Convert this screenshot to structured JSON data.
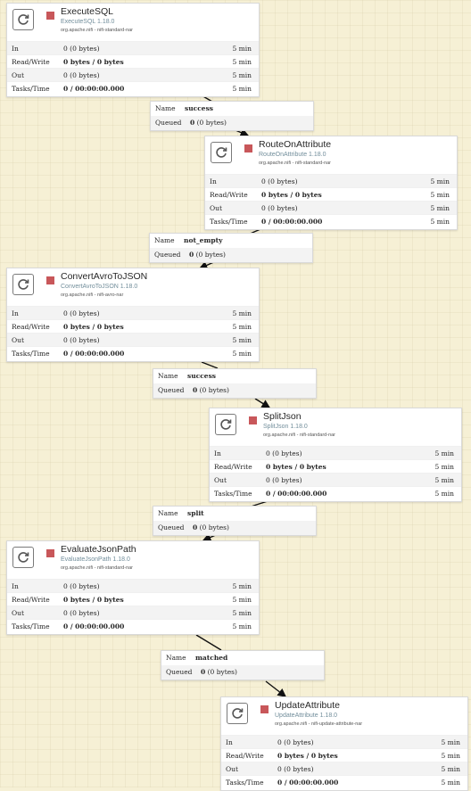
{
  "processors": [
    {
      "name": "ExecuteSQL",
      "type": "ExecuteSQL 1.18.0",
      "bundle": "org.apache.nifi - nifi-standard-nar",
      "stats": [
        {
          "label": "In",
          "value": "0 (0 bytes)",
          "time": "5 min"
        },
        {
          "label": "Read/Write",
          "value": "0 bytes / 0 bytes",
          "time": "5 min"
        },
        {
          "label": "Out",
          "value": "0 (0 bytes)",
          "time": "5 min"
        },
        {
          "label": "Tasks/Time",
          "value": "0 / 00:00:00.000",
          "time": "5 min"
        }
      ]
    },
    {
      "name": "RouteOnAttribute",
      "type": "RouteOnAttribute 1.18.0",
      "bundle": "org.apache.nifi - nifi-standard-nar",
      "stats": [
        {
          "label": "In",
          "value": "0 (0 bytes)",
          "time": "5 min"
        },
        {
          "label": "Read/Write",
          "value": "0 bytes / 0 bytes",
          "time": "5 min"
        },
        {
          "label": "Out",
          "value": "0 (0 bytes)",
          "time": "5 min"
        },
        {
          "label": "Tasks/Time",
          "value": "0 / 00:00:00.000",
          "time": "5 min"
        }
      ]
    },
    {
      "name": "ConvertAvroToJSON",
      "type": "ConvertAvroToJSON 1.18.0",
      "bundle": "org.apache.nifi - nifi-avro-nar",
      "stats": [
        {
          "label": "In",
          "value": "0 (0 bytes)",
          "time": "5 min"
        },
        {
          "label": "Read/Write",
          "value": "0 bytes / 0 bytes",
          "time": "5 min"
        },
        {
          "label": "Out",
          "value": "0 (0 bytes)",
          "time": "5 min"
        },
        {
          "label": "Tasks/Time",
          "value": "0 / 00:00:00.000",
          "time": "5 min"
        }
      ]
    },
    {
      "name": "SplitJson",
      "type": "SplitJson 1.18.0",
      "bundle": "org.apache.nifi - nifi-standard-nar",
      "stats": [
        {
          "label": "In",
          "value": "0 (0 bytes)",
          "time": "5 min"
        },
        {
          "label": "Read/Write",
          "value": "0 bytes / 0 bytes",
          "time": "5 min"
        },
        {
          "label": "Out",
          "value": "0 (0 bytes)",
          "time": "5 min"
        },
        {
          "label": "Tasks/Time",
          "value": "0 / 00:00:00.000",
          "time": "5 min"
        }
      ]
    },
    {
      "name": "EvaluateJsonPath",
      "type": "EvaluateJsonPath 1.18.0",
      "bundle": "org.apache.nifi - nifi-standard-nar",
      "stats": [
        {
          "label": "In",
          "value": "0 (0 bytes)",
          "time": "5 min"
        },
        {
          "label": "Read/Write",
          "value": "0 bytes / 0 bytes",
          "time": "5 min"
        },
        {
          "label": "Out",
          "value": "0 (0 bytes)",
          "time": "5 min"
        },
        {
          "label": "Tasks/Time",
          "value": "0 / 00:00:00.000",
          "time": "5 min"
        }
      ]
    },
    {
      "name": "UpdateAttribute",
      "type": "UpdateAttribute 1.18.0",
      "bundle": "org.apache.nifi - nifi-update-attribute-nar",
      "stats": [
        {
          "label": "In",
          "value": "0 (0 bytes)",
          "time": "5 min"
        },
        {
          "label": "Read/Write",
          "value": "0 bytes / 0 bytes",
          "time": "5 min"
        },
        {
          "label": "Out",
          "value": "0 (0 bytes)",
          "time": "5 min"
        },
        {
          "label": "Tasks/Time",
          "value": "0 / 00:00:00.000",
          "time": "5 min"
        }
      ]
    }
  ],
  "connections": [
    {
      "name_label": "Name",
      "name": "success",
      "queued_label": "Queued",
      "queued": "0",
      "queued_size": "(0 bytes)"
    },
    {
      "name_label": "Name",
      "name": "not_empty",
      "queued_label": "Queued",
      "queued": "0",
      "queued_size": "(0 bytes)"
    },
    {
      "name_label": "Name",
      "name": "success",
      "queued_label": "Queued",
      "queued": "0",
      "queued_size": "(0 bytes)"
    },
    {
      "name_label": "Name",
      "name": "split",
      "queued_label": "Queued",
      "queued": "0",
      "queued_size": "(0 bytes)"
    },
    {
      "name_label": "Name",
      "name": "matched",
      "queued_label": "Queued",
      "queued": "0",
      "queued_size": "(0 bytes)"
    }
  ],
  "colors": {
    "canvas": "#f6f0d5",
    "stopped_status": "#c8575a",
    "type_text": "#728e9b",
    "edge": "#111111"
  },
  "icons": {
    "processor_icon": "refresh-icon",
    "run_status_icon": "stopped-square-icon"
  }
}
